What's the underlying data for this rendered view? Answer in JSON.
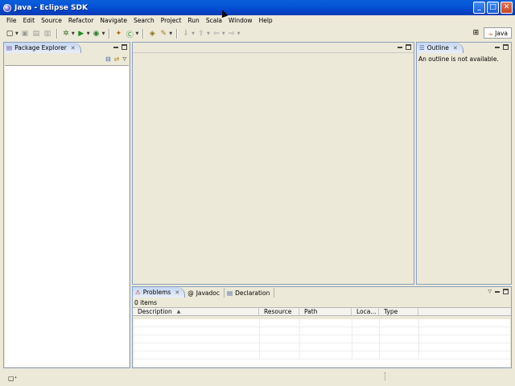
{
  "window": {
    "title": "Java - Eclipse SDK",
    "controls": {
      "minimize": "_",
      "maximize": "□",
      "close": "✕"
    }
  },
  "menu": [
    "File",
    "Edit",
    "Source",
    "Refactor",
    "Navigate",
    "Search",
    "Project",
    "Run",
    "Scala",
    "Window",
    "Help"
  ],
  "toolbar": {
    "icons": [
      {
        "name": "new-icon",
        "glyph": "▢"
      },
      {
        "name": "save-icon",
        "glyph": "▣"
      },
      {
        "name": "save-all-icon",
        "glyph": "▤"
      },
      {
        "name": "print-icon",
        "glyph": "▥"
      },
      {
        "name": "debug-icon",
        "glyph": "✲"
      },
      {
        "name": "run-icon",
        "glyph": "▶"
      },
      {
        "name": "external-tools-icon",
        "glyph": "◉"
      },
      {
        "name": "new-java-project-icon",
        "glyph": "✦"
      },
      {
        "name": "new-class-icon",
        "glyph": "Ⓒ"
      },
      {
        "name": "open-type-icon",
        "glyph": "◈"
      },
      {
        "name": "search-icon",
        "glyph": "✎"
      },
      {
        "name": "next-annotation-icon",
        "glyph": "⇩"
      },
      {
        "name": "prev-annotation-icon",
        "glyph": "⇧"
      },
      {
        "name": "back-icon",
        "glyph": "⇦"
      },
      {
        "name": "forward-icon",
        "glyph": "⇨"
      }
    ]
  },
  "perspective": {
    "label": "Java"
  },
  "package_explorer": {
    "tab_label": "Package Explorer"
  },
  "outline": {
    "tab_label": "Outline",
    "message": "An outline is not available."
  },
  "bottom_panel": {
    "tabs": [
      "Problems",
      "Javadoc",
      "Declaration"
    ],
    "items_count": "0 items",
    "columns": [
      "Description",
      "Resource",
      "Path",
      "Loca...",
      "Type"
    ]
  },
  "colors": {
    "title_bar": "#0556d8",
    "chrome": "#ece9d8",
    "view_border": "#8c9fbd",
    "active_tab": "#c5d7f2"
  }
}
